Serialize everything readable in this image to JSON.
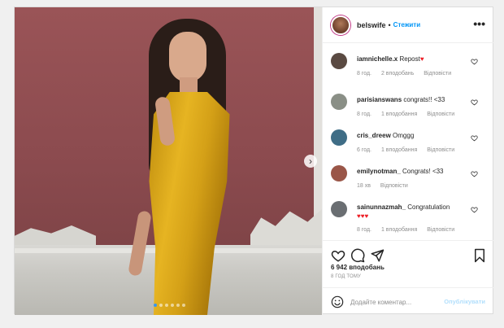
{
  "post": {
    "author": "belswife",
    "separator": "•",
    "follow_label": "Стежити",
    "more_icon": "more-horizontal-icon",
    "more_label": "•••"
  },
  "media": {
    "next_icon": "chevron-right-icon",
    "next_label": "›",
    "carousel_pages": 6,
    "active_page": 1
  },
  "comments": [
    {
      "user": "iamnichelle.x",
      "text": "Repost",
      "has_heart": true,
      "hearts_in_text": "♥",
      "age": "8 год.",
      "likes": "2 вподобань",
      "reply": "Відповісти",
      "avatar_color": "#5a4a42"
    },
    {
      "user": "parisianswans",
      "text": "congrats!! <33",
      "has_heart": false,
      "age": "8 год.",
      "likes": "1 вподобання",
      "reply": "Відповісти",
      "avatar_color": "#8a8f86"
    },
    {
      "user": "cris_dreew",
      "text": "Omggg",
      "has_heart": false,
      "age": "6 год.",
      "likes": "1 вподобання",
      "reply": "Відповісти",
      "avatar_color": "#3f6d86"
    },
    {
      "user": "emilynotman_",
      "text": "Congrats! <33",
      "has_heart": false,
      "age": "18 хв",
      "likes": "",
      "reply": "Відповісти",
      "avatar_color": "#9a5648"
    },
    {
      "user": "sainunnazmah_",
      "text": "Congratulation",
      "has_heart": false,
      "hearts_line": "♥♥♥",
      "age": "8 год.",
      "likes": "1 вподобання",
      "reply": "Відповісти",
      "avatar_color": "#6a6e72"
    }
  ],
  "actions": {
    "like_icon": "heart-outline-icon",
    "comment_icon": "comment-bubble-icon",
    "share_icon": "paper-plane-icon",
    "save_icon": "bookmark-icon"
  },
  "likes_count": "6 942 вподобань",
  "timestamp": "8 ГОД ТОМУ",
  "add_comment": {
    "emoji_icon": "smiley-icon",
    "placeholder": "Додайте коментар...",
    "publish_label": "Опублікувати"
  },
  "colors": {
    "accent": "#0095f6",
    "heart_red": "#ed1c24",
    "publish_disabled": "#b2dffc"
  }
}
